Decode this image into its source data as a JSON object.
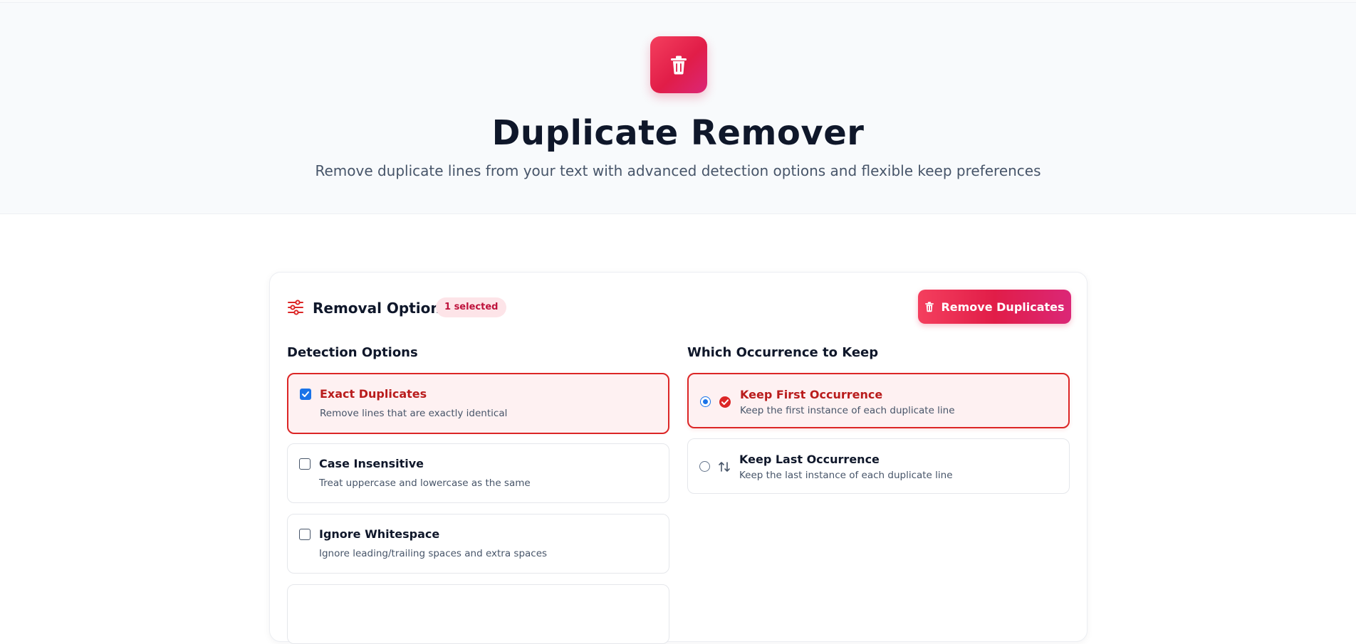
{
  "hero": {
    "title": "Duplicate Remover",
    "subtitle": "Remove duplicate lines from your text with advanced detection options and flexible keep preferences",
    "icon": "trash-icon"
  },
  "options_card": {
    "title": "Removal Options",
    "selected_badge": "1 selected",
    "remove_button_label": "Remove Duplicates",
    "detection": {
      "heading": "Detection Options",
      "items": [
        {
          "label": "Exact Duplicates",
          "description": "Remove lines that are exactly identical",
          "checked": true
        },
        {
          "label": "Case Insensitive",
          "description": "Treat uppercase and lowercase as the same",
          "checked": false
        },
        {
          "label": "Ignore Whitespace",
          "description": "Ignore leading/trailing spaces and extra spaces",
          "checked": false
        }
      ]
    },
    "keep": {
      "heading": "Which Occurrence to Keep",
      "items": [
        {
          "label": "Keep First Occurrence",
          "description": "Keep the first instance of each duplicate line",
          "selected": true,
          "icon": "check-circle-icon"
        },
        {
          "label": "Keep Last Occurrence",
          "description": "Keep the last instance of each duplicate line",
          "selected": false,
          "icon": "sort-arrows-icon"
        }
      ]
    }
  },
  "colors": {
    "accent": "#e11d48",
    "accent_pink": "#db2777",
    "selected_border": "#dc2626",
    "selected_bg": "#fef1f2",
    "checkbox_blue": "#1a73e8"
  }
}
